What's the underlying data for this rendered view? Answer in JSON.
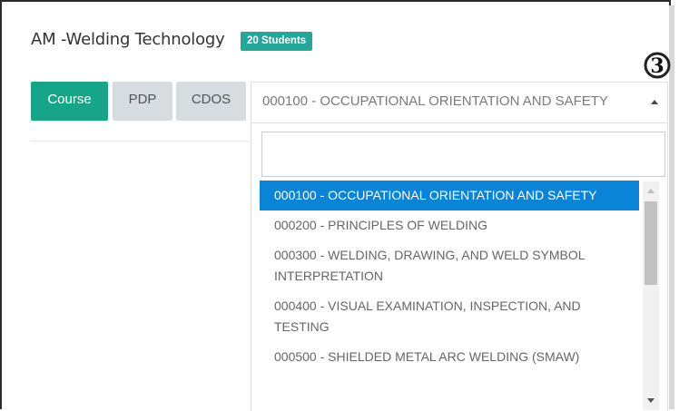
{
  "header": {
    "title": "AM -Welding Technology",
    "badge": "20 Students"
  },
  "step_marker": "3",
  "tabs": [
    {
      "label": "Course",
      "active": true
    },
    {
      "label": "PDP",
      "active": false
    },
    {
      "label": "CDOS",
      "active": false
    }
  ],
  "select": {
    "value": "000100 - OCCUPATIONAL ORIENTATION AND SAFETY",
    "search_value": ""
  },
  "options": [
    {
      "label": "000100 - OCCUPATIONAL ORIENTATION AND SAFETY",
      "selected": true
    },
    {
      "label": "000200 - PRINCIPLES OF WELDING",
      "selected": false
    },
    {
      "label": "000300 - WELDING, DRAWING, AND WELD SYMBOL INTERPRETATION",
      "selected": false
    },
    {
      "label": "000400 - VISUAL EXAMINATION, INSPECTION, AND TESTING",
      "selected": false
    },
    {
      "label": "000500 - SHIELDED METAL ARC WELDING (SMAW)",
      "selected": false
    }
  ],
  "colors": {
    "badge": "#26a69a",
    "active_tab": "#17a589",
    "inactive_tab": "#d7dce0",
    "selected_option": "#0a84d6"
  }
}
